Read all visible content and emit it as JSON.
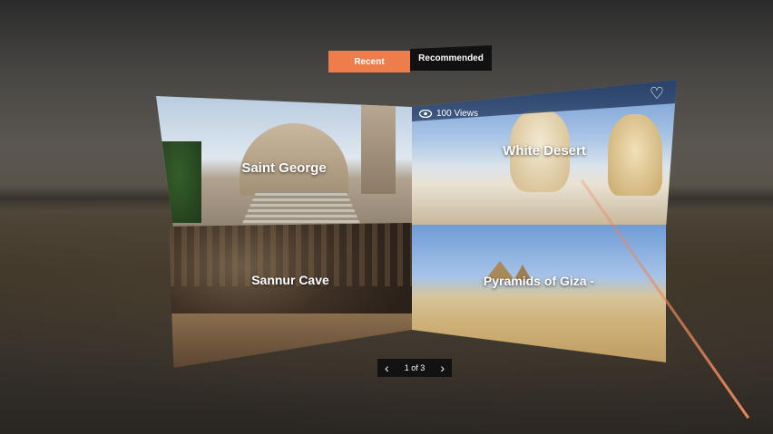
{
  "tabs": {
    "recent": "Recent",
    "recommended": "Recommended",
    "active_color": "#ef7d4b"
  },
  "tiles": [
    {
      "title": "Saint George"
    },
    {
      "title": "White Desert",
      "views": "100 Views"
    },
    {
      "title": "Sannur Cave"
    },
    {
      "title": "Pyramids of Giza -"
    }
  ],
  "icons": {
    "views": "eye-icon",
    "favorite": "heart-icon",
    "prev": "chevron-left-icon",
    "next": "chevron-right-icon"
  },
  "pager": {
    "label": "1 of 3"
  }
}
